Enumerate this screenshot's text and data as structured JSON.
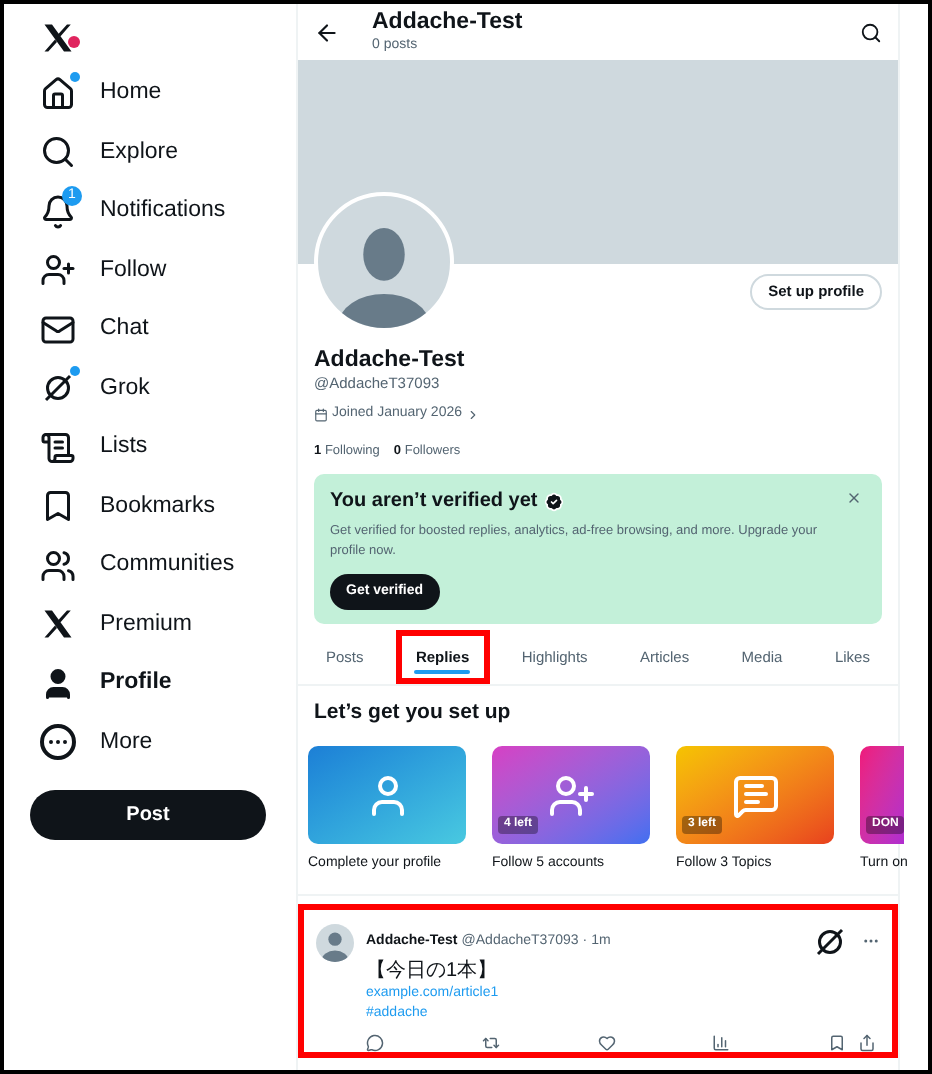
{
  "sidebar": {
    "items": [
      {
        "kind": "home",
        "label": "Home",
        "selected": false,
        "dot": true
      },
      {
        "kind": "explore",
        "label": "Explore",
        "selected": false
      },
      {
        "kind": "notifications",
        "label": "Notifications",
        "selected": false,
        "badge": "1"
      },
      {
        "kind": "follow",
        "label": "Follow",
        "selected": false
      },
      {
        "kind": "chat",
        "label": "Chat",
        "selected": false
      },
      {
        "kind": "grok",
        "label": "Grok",
        "selected": false,
        "dot": true
      },
      {
        "kind": "lists",
        "label": "Lists",
        "selected": false
      },
      {
        "kind": "bookmarks",
        "label": "Bookmarks",
        "selected": false
      },
      {
        "kind": "communities",
        "label": "Communities",
        "selected": false
      },
      {
        "kind": "premium",
        "label": "Premium",
        "selected": false
      },
      {
        "kind": "profile",
        "label": "Profile",
        "selected": true
      },
      {
        "kind": "more",
        "label": "More",
        "selected": false
      }
    ],
    "post_button": "Post"
  },
  "header": {
    "title": "Addache-Test",
    "subtitle": "0 posts"
  },
  "profile": {
    "setup_button": "Set up profile",
    "name": "Addache-Test",
    "handle": "@AddacheT37093",
    "joined": "Joined January 2026",
    "following_count": "1",
    "following_label": "Following",
    "followers_count": "0",
    "followers_label": "Followers"
  },
  "verify_card": {
    "title": "You aren’t verified yet",
    "text": "Get verified for boosted replies, analytics, ad-free browsing, and more. Upgrade your profile now.",
    "button": "Get verified"
  },
  "tabs": [
    {
      "label": "Posts",
      "selected": false,
      "highlighted": false
    },
    {
      "label": "Replies",
      "selected": true,
      "highlighted": true
    },
    {
      "label": "Highlights",
      "selected": false,
      "highlighted": false
    },
    {
      "label": "Articles",
      "selected": false,
      "highlighted": false
    },
    {
      "label": "Media",
      "selected": false,
      "highlighted": false
    },
    {
      "label": "Likes",
      "selected": false,
      "highlighted": false
    }
  ],
  "setup": {
    "title": "Let’s get you set up",
    "cards": [
      {
        "kind": "profile",
        "label": "Complete your profile"
      },
      {
        "kind": "follow",
        "badge": "4 left",
        "label": "Follow 5 accounts"
      },
      {
        "kind": "topics",
        "badge": "3 left",
        "label": "Follow 3 Topics"
      },
      {
        "kind": "notifications",
        "badge": "DON",
        "label": "Turn on"
      }
    ]
  },
  "post": {
    "highlighted": true,
    "name": "Addache-Test",
    "handle": "@AddacheT37093",
    "dot": "·",
    "time": "1m",
    "lines": [
      "【今日の1本】"
    ],
    "link": "example.com/article1",
    "hashtag": "#addache"
  }
}
